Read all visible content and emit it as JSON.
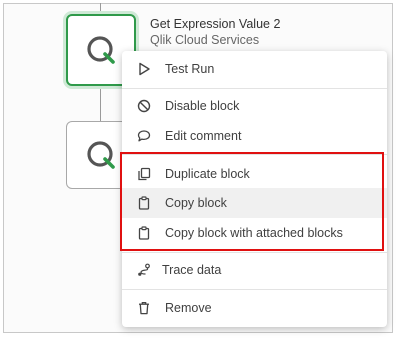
{
  "block": {
    "title": "Get Expression Value 2",
    "subtitle": "Qlik Cloud Services"
  },
  "menu": {
    "items": [
      {
        "id": "test-run",
        "label": "Test Run",
        "icon": "play-icon"
      },
      {
        "id": "disable-block",
        "label": "Disable block",
        "icon": "ban-icon"
      },
      {
        "id": "edit-comment",
        "label": "Edit comment",
        "icon": "comment-icon"
      },
      {
        "id": "duplicate-block",
        "label": "Duplicate block",
        "icon": "duplicate-icon"
      },
      {
        "id": "copy-block",
        "label": "Copy block",
        "icon": "clipboard-icon"
      },
      {
        "id": "copy-block-attached",
        "label": "Copy block with attached blocks",
        "icon": "clipboard-icon"
      },
      {
        "id": "trace-data",
        "label": "Trace data",
        "icon": "trace-icon"
      },
      {
        "id": "remove",
        "label": "Remove",
        "icon": "trash-icon"
      }
    ]
  },
  "colors": {
    "selected_border": "#2f9a4a",
    "qlik_green": "#2f9a4a",
    "highlight_box": "#e01010",
    "hover_bg": "#f0f0f0"
  }
}
